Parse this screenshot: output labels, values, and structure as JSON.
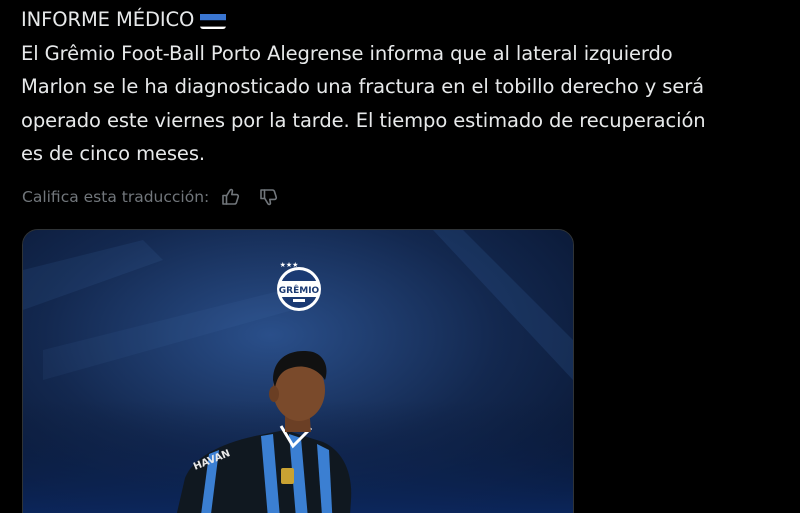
{
  "tweet": {
    "heading": "INFORME MÉDICO",
    "heading_emoji": "estonia-flag-icon",
    "body_lines": [
      "El Grêmio Foot-Ball Porto Alegrense informa que al lateral izquierdo",
      "Marlon se le ha diagnosticado una fractura en el tobillo derecho y será",
      "operado este viernes por la tarde. El tiempo estimado de recuperación",
      "es de cinco meses."
    ]
  },
  "translation": {
    "rate_label": "Califica esta traducción:",
    "thumbs_up_icon": "thumbs-up-icon",
    "thumbs_down_icon": "thumbs-down-icon"
  },
  "media": {
    "crest_label": "GRÊMIO",
    "jersey_sponsor": "HAVAN"
  },
  "colors": {
    "background": "#000000",
    "text": "#e7e9ea",
    "muted": "#71767b",
    "flag_blue": "#3a76d1",
    "flag_black": "#000000",
    "flag_white": "#ffffff"
  }
}
